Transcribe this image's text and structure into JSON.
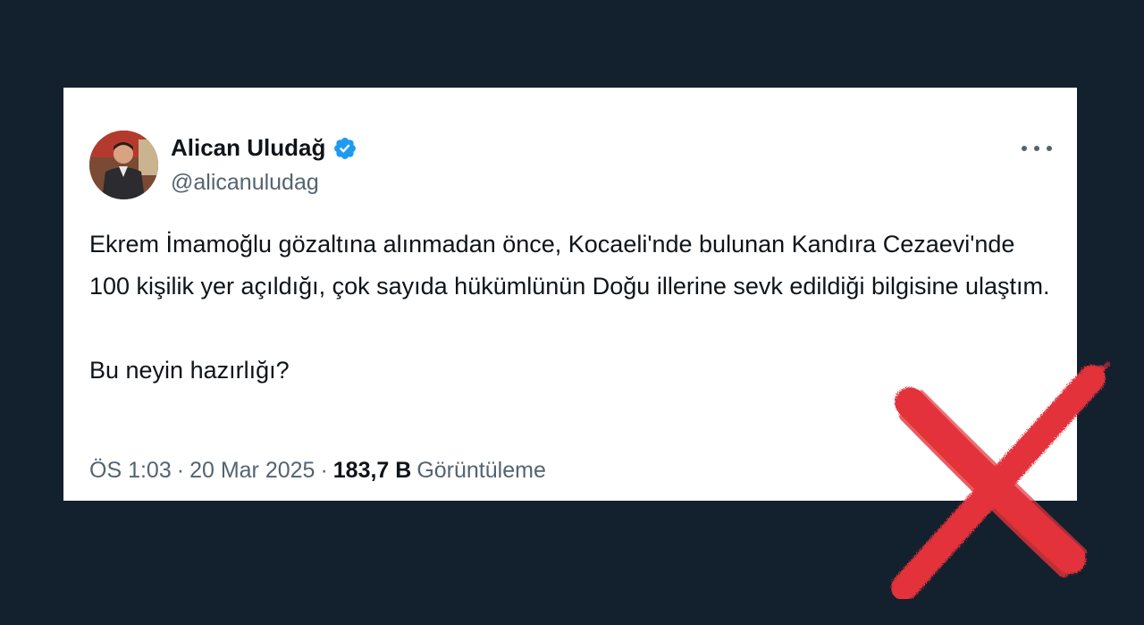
{
  "tweet": {
    "author_name": "Alican Uludağ",
    "author_handle": "@alicanuludag",
    "verified": true,
    "verified_color": "#1d9bf0",
    "text_paragraphs": [
      "Ekrem İmamoğlu gözaltına alınmadan önce, Kocaeli'nde bulunan Kandıra Cezaevi'nde 100 kişilik yer açıldığı, çok sayıda hükümlünün Doğu illerine sevk edildiği bilgisine ulaştım.",
      "Bu neyin hazırlığı?"
    ],
    "time": "ÖS 1:03",
    "separator": "·",
    "date": "20 Mar 2025",
    "views_count": "183,7 B",
    "views_label": "Görüntüleme"
  },
  "icons": {
    "more": "more-horizontal-icon",
    "verified": "verified-badge-icon",
    "cross": "red-cross-mark"
  },
  "colors": {
    "background": "#13202d",
    "card": "#ffffff",
    "text": "#0f1419",
    "secondary_text": "#536471",
    "cross_mark": "#e3323a"
  }
}
